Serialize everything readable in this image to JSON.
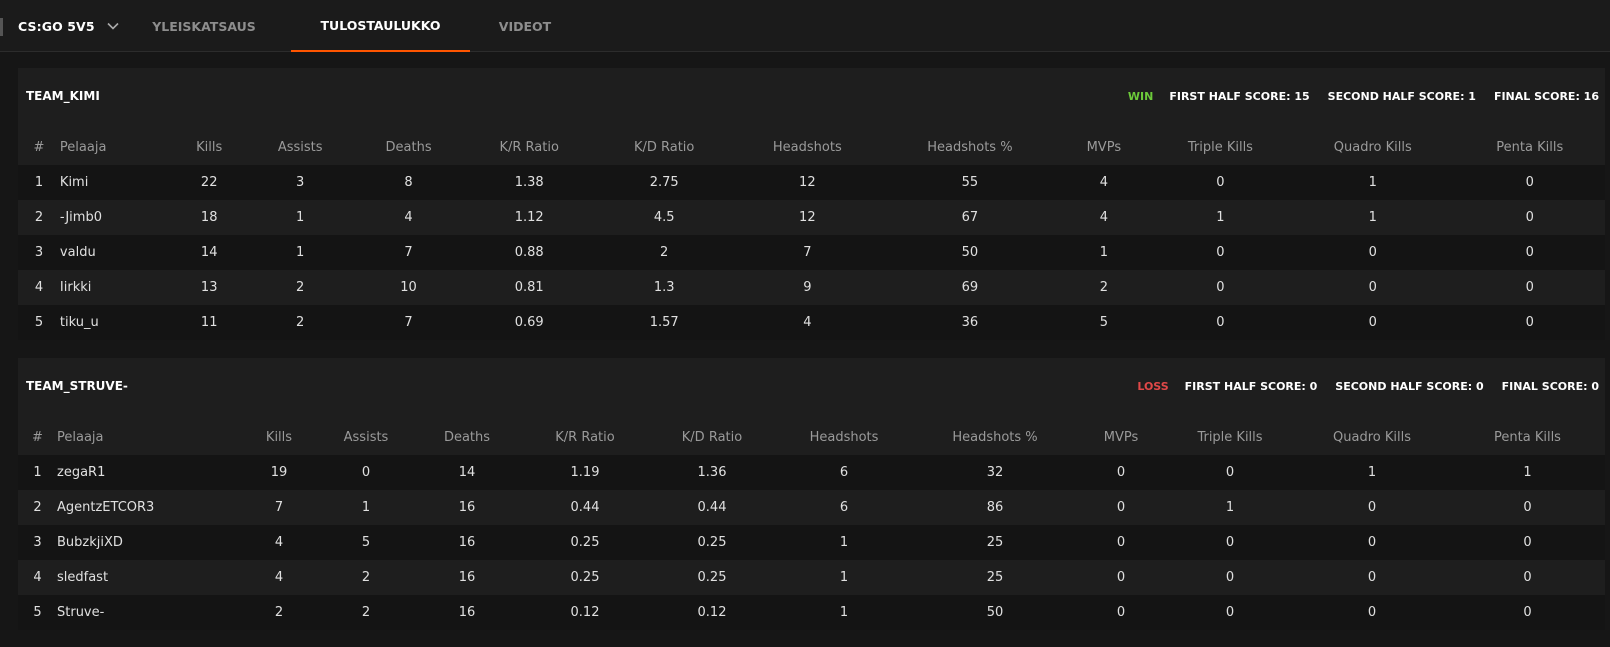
{
  "header": {
    "game": "CS:GO 5V5",
    "tabs": [
      {
        "label": "YLEISKATSAUS",
        "active": false
      },
      {
        "label": "TULOSTAULUKKO",
        "active": true
      },
      {
        "label": "VIDEOT",
        "active": false
      }
    ]
  },
  "colors": {
    "accent": "#ff5500",
    "win": "#6cc93a",
    "loss": "#e04848"
  },
  "columns": [
    "#",
    "Pelaaja",
    "Kills",
    "Assists",
    "Deaths",
    "K/R Ratio",
    "K/D Ratio",
    "Headshots",
    "Headshots %",
    "MVPs",
    "Triple Kills",
    "Quadro Kills",
    "Penta Kills"
  ],
  "teams": [
    {
      "name": "TEAM_KIMI",
      "result": "WIN",
      "first_half": "FIRST HALF SCORE: 15",
      "second_half": "SECOND HALF SCORE: 1",
      "final": "FINAL SCORE: 16",
      "players": [
        [
          "1",
          "Kimi",
          "22",
          "3",
          "8",
          "1.38",
          "2.75",
          "12",
          "55",
          "4",
          "0",
          "1",
          "0"
        ],
        [
          "2",
          "-Jimb0",
          "18",
          "1",
          "4",
          "1.12",
          "4.5",
          "12",
          "67",
          "4",
          "1",
          "1",
          "0"
        ],
        [
          "3",
          "valdu",
          "14",
          "1",
          "7",
          "0.88",
          "2",
          "7",
          "50",
          "1",
          "0",
          "0",
          "0"
        ],
        [
          "4",
          "Iirkki",
          "13",
          "2",
          "10",
          "0.81",
          "1.3",
          "9",
          "69",
          "2",
          "0",
          "0",
          "0"
        ],
        [
          "5",
          "tiku_u",
          "11",
          "2",
          "7",
          "0.69",
          "1.57",
          "4",
          "36",
          "5",
          "0",
          "0",
          "0"
        ]
      ]
    },
    {
      "name": "TEAM_STRUVE-",
      "result": "LOSS",
      "first_half": "FIRST HALF SCORE: 0",
      "second_half": "SECOND HALF SCORE: 0",
      "final": "FINAL SCORE: 0",
      "players": [
        [
          "1",
          "zegaR1",
          "19",
          "0",
          "14",
          "1.19",
          "1.36",
          "6",
          "32",
          "0",
          "0",
          "1",
          "1"
        ],
        [
          "2",
          "AgentzETCOR3",
          "7",
          "1",
          "16",
          "0.44",
          "0.44",
          "6",
          "86",
          "0",
          "1",
          "0",
          "0"
        ],
        [
          "3",
          "BubzkjiXD",
          "4",
          "5",
          "16",
          "0.25",
          "0.25",
          "1",
          "25",
          "0",
          "0",
          "0",
          "0"
        ],
        [
          "4",
          "sledfast",
          "4",
          "2",
          "16",
          "0.25",
          "0.25",
          "1",
          "25",
          "0",
          "0",
          "0",
          "0"
        ],
        [
          "5",
          "Struve-",
          "2",
          "2",
          "16",
          "0.12",
          "0.12",
          "1",
          "50",
          "0",
          "0",
          "0",
          "0"
        ]
      ]
    }
  ]
}
